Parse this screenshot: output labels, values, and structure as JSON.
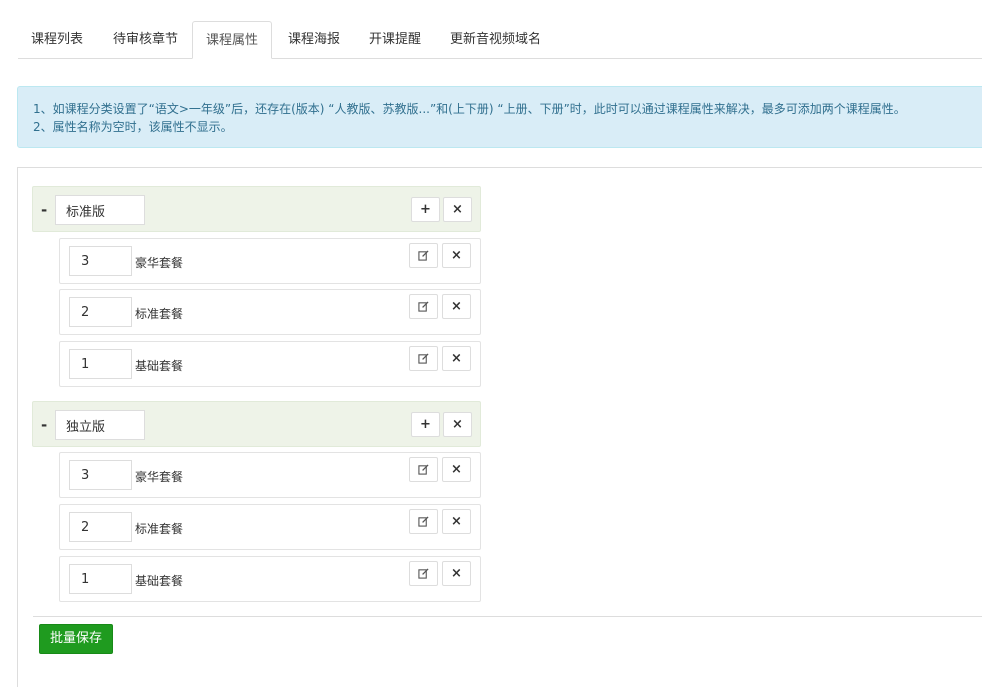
{
  "tabs": [
    {
      "label": "课程列表"
    },
    {
      "label": "待审核章节"
    },
    {
      "label": "课程属性",
      "active": true
    },
    {
      "label": "课程海报"
    },
    {
      "label": "开课提醒"
    },
    {
      "label": "更新音视频域名"
    }
  ],
  "notice": {
    "line1": "1、如课程分类设置了“语文>一年级”后，还存在(版本) “人教版、苏教版...”和(上下册) “上册、下册”时，此时可以通过课程属性来解决，最多可添加两个课程属性。",
    "line2": "2、属性名称为空时，该属性不显示。"
  },
  "groups": [
    {
      "collapse_symbol": "-",
      "name": "标准版",
      "add_symbol": "+",
      "delete_symbol": "×",
      "items": [
        {
          "value": "3",
          "label": "豪华套餐"
        },
        {
          "value": "2",
          "label": "标准套餐"
        },
        {
          "value": "1",
          "label": "基础套餐"
        }
      ]
    },
    {
      "collapse_symbol": "-",
      "name": "独立版",
      "add_symbol": "+",
      "delete_symbol": "×",
      "items": [
        {
          "value": "3",
          "label": "豪华套餐"
        },
        {
          "value": "2",
          "label": "标准套餐"
        },
        {
          "value": "1",
          "label": "基础套餐"
        }
      ]
    }
  ],
  "save_button": {
    "label": "批量保存"
  },
  "icons": {
    "edit": "edit-icon",
    "delete": "close-icon",
    "add": "plus-icon"
  },
  "colors": {
    "save": "#1f9b1f",
    "notice_bg": "#d9edf7",
    "group_bg": "#eef3e8"
  }
}
